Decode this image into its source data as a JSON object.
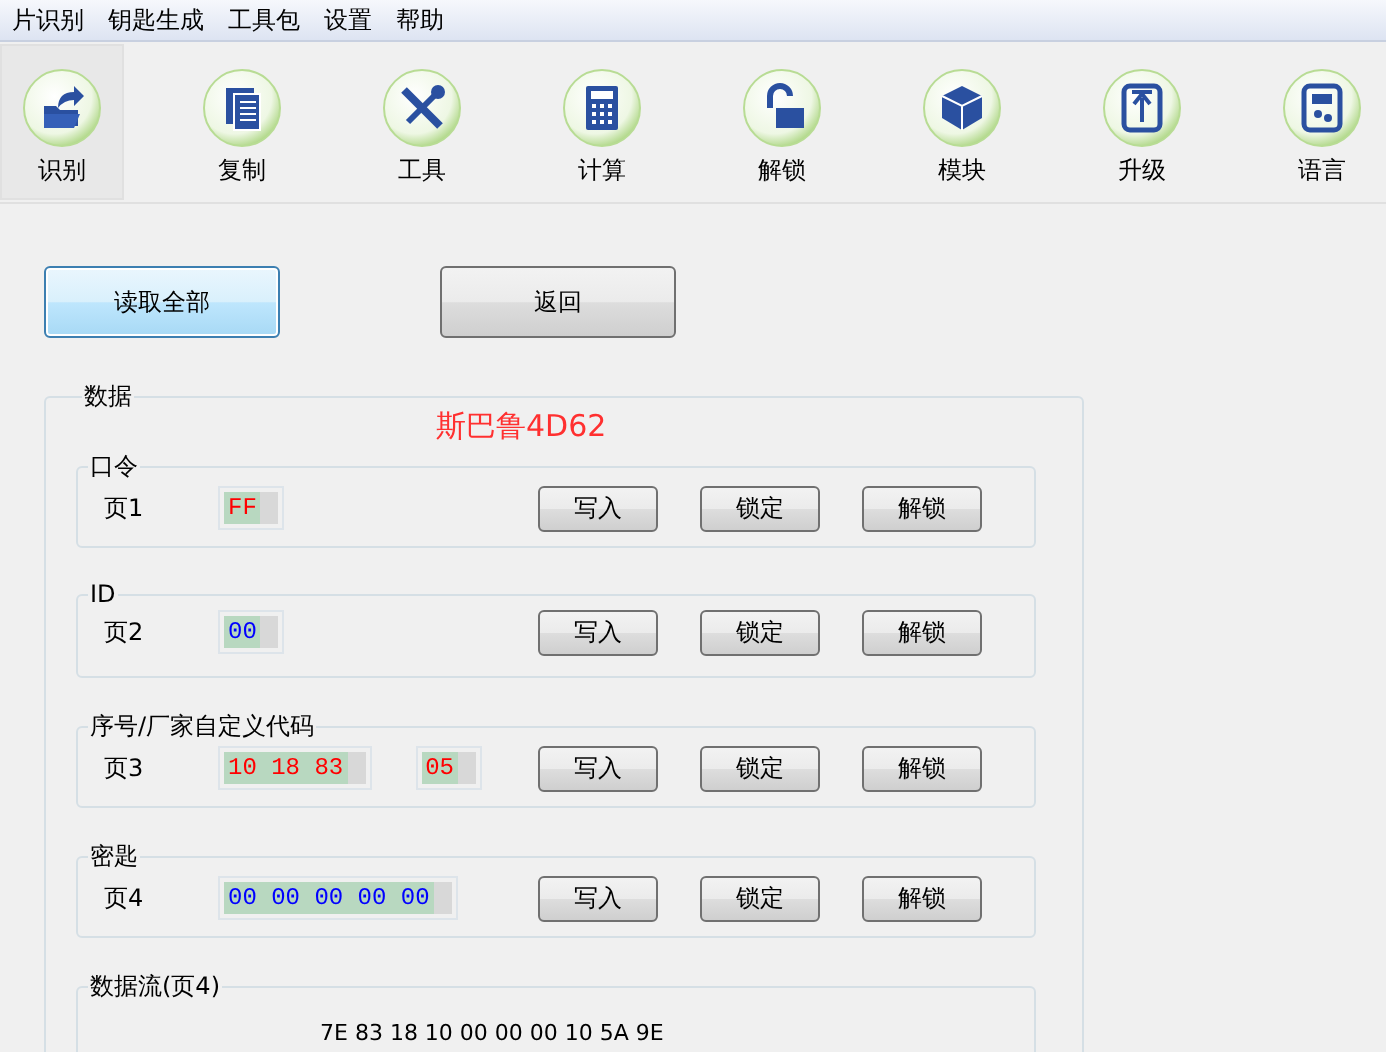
{
  "menu": [
    {
      "label": "片识别"
    },
    {
      "label": "钥匙生成"
    },
    {
      "label": "工具包"
    },
    {
      "label": "设置"
    },
    {
      "label": "帮助"
    }
  ],
  "toolbar": [
    {
      "label": "识别",
      "selected": true
    },
    {
      "label": "复制",
      "selected": false
    },
    {
      "label": "工具",
      "selected": false
    },
    {
      "label": "计算",
      "selected": false
    },
    {
      "label": "解锁",
      "selected": false
    },
    {
      "label": "模块",
      "selected": false
    },
    {
      "label": "升级",
      "selected": false
    },
    {
      "label": "语言",
      "selected": false
    }
  ],
  "actions": [
    {
      "label": "读取全部",
      "selected": true
    },
    {
      "label": "返回",
      "selected": false
    }
  ],
  "data_panel": {
    "title": "数据",
    "chip_name": "斯巴鲁4D62",
    "groups": [
      {
        "title": "口令",
        "page": "页1",
        "fields": [
          {
            "value": "FF",
            "color": "#ff0000"
          }
        ],
        "buttons": [
          "写入",
          "锁定",
          "解锁"
        ]
      },
      {
        "title": "ID",
        "page": "页2",
        "fields": [
          {
            "value": "00",
            "color": "#0000ff"
          }
        ],
        "buttons": [
          "写入",
          "锁定",
          "解锁"
        ]
      },
      {
        "title": "序号/厂家自定义代码",
        "page": "页3",
        "fields": [
          {
            "value": "10 18 83",
            "color": "#ff0000"
          },
          {
            "value": "05",
            "color": "#ff0000"
          }
        ],
        "buttons": [
          "写入",
          "锁定",
          "解锁"
        ]
      },
      {
        "title": "密匙",
        "page": "页4",
        "fields": [
          {
            "value": "00 00 00 00 00",
            "color": "#0000ff"
          }
        ],
        "buttons": [
          "写入",
          "锁定",
          "解锁"
        ]
      }
    ],
    "stream": {
      "title": "数据流(页4)",
      "value": "7E 83 18 10 00 00 00 10 5A 9E"
    }
  }
}
